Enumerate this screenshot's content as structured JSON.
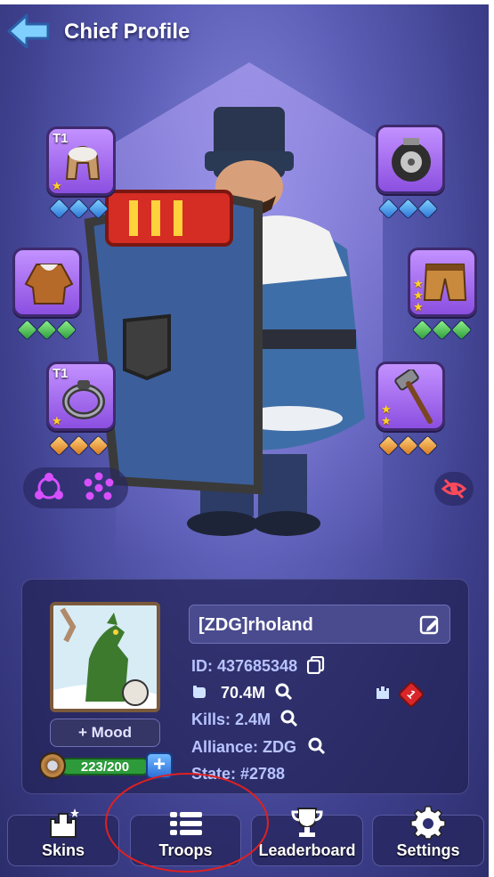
{
  "header": {
    "title": "Chief Profile"
  },
  "equipment": {
    "hat": {
      "tier": "T1",
      "stars": 1,
      "gem_color": "blue"
    },
    "wheel": {
      "stars": 0,
      "gem_color": "blue"
    },
    "coat": {
      "stars": 0,
      "gem_color": "green"
    },
    "pants": {
      "stars": 3,
      "gem_color": "green"
    },
    "ring": {
      "tier": "T1",
      "stars": 1,
      "gem_color": "orange"
    },
    "hammer": {
      "stars": 2,
      "gem_color": "orange"
    }
  },
  "profile": {
    "name": "[ZDG]rholand",
    "id_label": "ID: 437685348",
    "power": "70.4M",
    "kills": "Kills: 2.4M",
    "alliance": "Alliance: ZDG",
    "state": "State: #2788",
    "rank_badge": "1",
    "mood_label": "Mood",
    "food": "223/200"
  },
  "bottom_nav": {
    "skins": "Skins",
    "troops": "Troops",
    "leaderboard": "Leaderboard",
    "settings": "Settings"
  },
  "colors": {
    "accent": "#8b4fe0",
    "annotation": "#e02020"
  }
}
